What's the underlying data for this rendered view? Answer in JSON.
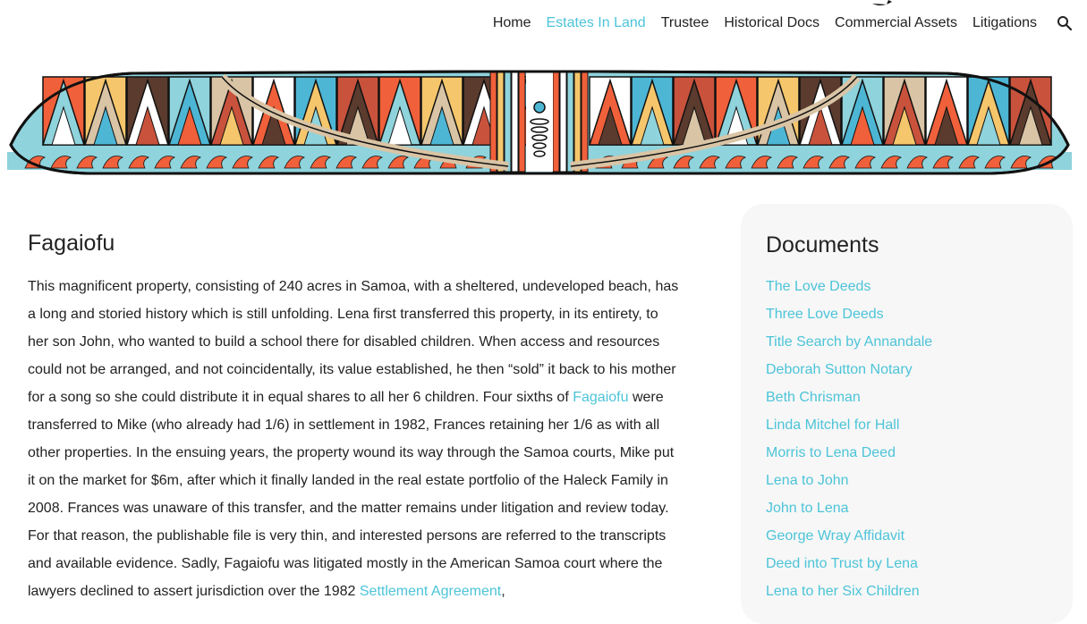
{
  "nav": {
    "items": [
      "Home",
      "Estates In Land",
      "Trustee",
      "Historical Docs",
      "Commercial Assets",
      "Litigations"
    ],
    "active_index": 1
  },
  "icons": {
    "search": "search-icon"
  },
  "colors": {
    "accent": "#4cc4d8",
    "text": "#222222",
    "sidebar_bg": "#f7f7f7"
  },
  "article": {
    "title": "Fagaiofu",
    "p1": "This magnificent property, consisting of 240 acres in Samoa, with a sheltered, undeveloped beach, has a long and storied history which is still unfolding. Lena first transferred this property, in its entirety, to her son John, who wanted to build a school there for disabled children. When access and resources could not be arranged, and not coincidentally, its value established, he then “sold” it back to his mother for a song so she could distribute it in equal shares to all her 6 children. Four sixths of",
    "link1": "Fagaiofu",
    "p2": "were transferred to Mike (who already had 1/6) in settlement in 1982, Frances retaining her 1/6 as with all other properties. In the ensuing years, the property wound its way through the Samoa courts, Mike put it on the market for $6m, after which it finally landed in the real estate portfolio of the Haleck Family in 2008. Frances was unaware of this transfer, and the matter remains under litigation and review today. For that reason, the publishable file is very thin, and interested persons are referred to the transcripts and available evidence.  Sadly, Fagaiofu was litigated mostly in the American Samoa court where the lawyers declined to assert jurisdiction over the 1982",
    "link2": "Settlement Agreement",
    "p3": ","
  },
  "sidebar": {
    "title": "Documents",
    "links": [
      "The Love Deeds",
      "Three Love Deeds",
      "Title Search by Annandale",
      "Deborah Sutton Notary",
      "Beth Chrisman",
      "Linda Mitchel for Hall",
      "Morris to Lena Deed",
      "Lena to John",
      "John to Lena",
      "George Wray Affidavit",
      "Deed into Trust by Lena",
      "Lena to her Six Children"
    ]
  }
}
